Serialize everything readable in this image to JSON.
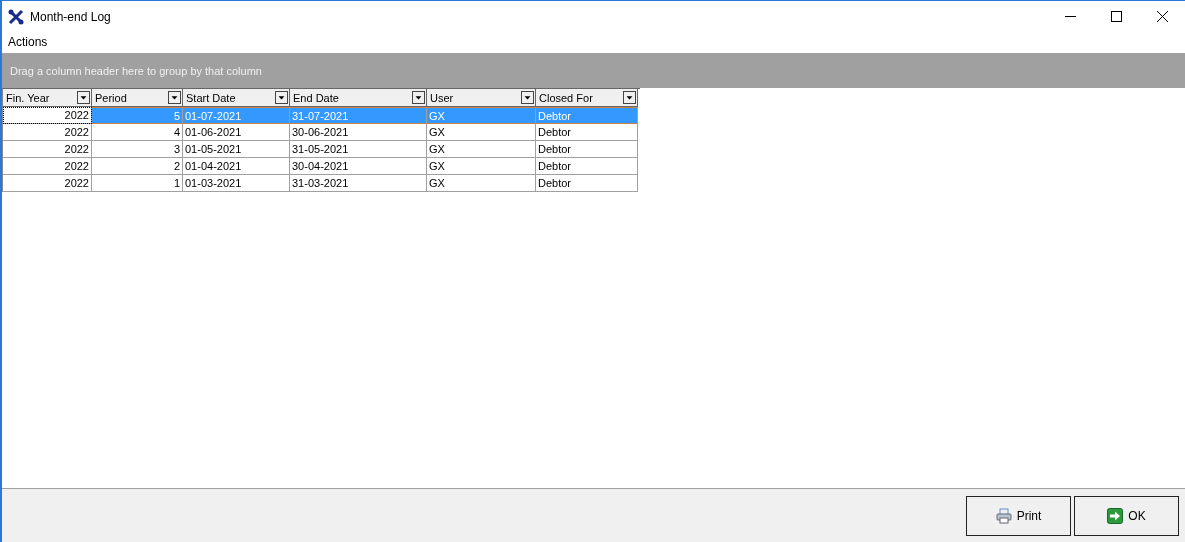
{
  "window": {
    "title": "Month-end Log"
  },
  "menu": [
    "Actions"
  ],
  "group_panel": {
    "hint": "Drag a column header here to group by that column"
  },
  "table": {
    "columns": [
      {
        "label": "Fin. Year",
        "kind": "number"
      },
      {
        "label": "Period",
        "kind": "number"
      },
      {
        "label": "Start Date",
        "kind": "text"
      },
      {
        "label": "End Date",
        "kind": "text"
      },
      {
        "label": "User",
        "kind": "text"
      },
      {
        "label": "Closed For",
        "kind": "text"
      }
    ],
    "rows": [
      {
        "selected": true,
        "cells": [
          "2022",
          "5",
          "01-07-2021",
          "31-07-2021",
          "GX",
          "Debtor"
        ]
      },
      {
        "selected": false,
        "cells": [
          "2022",
          "4",
          "01-06-2021",
          "30-06-2021",
          "GX",
          "Debtor"
        ]
      },
      {
        "selected": false,
        "cells": [
          "2022",
          "3",
          "01-05-2021",
          "31-05-2021",
          "GX",
          "Debtor"
        ]
      },
      {
        "selected": false,
        "cells": [
          "2022",
          "2",
          "01-04-2021",
          "30-04-2021",
          "GX",
          "Debtor"
        ]
      },
      {
        "selected": false,
        "cells": [
          "2022",
          "1",
          "01-03-2021",
          "31-03-2021",
          "GX",
          "Debtor"
        ]
      }
    ]
  },
  "buttons": [
    {
      "kind": "print",
      "label": "Print"
    },
    {
      "kind": "ok",
      "label": "OK"
    }
  ]
}
